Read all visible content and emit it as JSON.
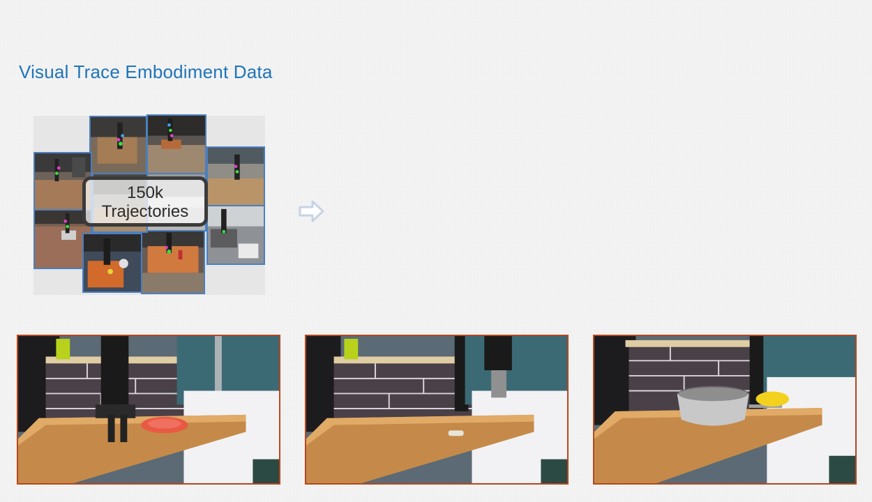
{
  "header": {
    "title": "Visual Trace Embodiment Data"
  },
  "collage": {
    "badge_line1": "150k",
    "badge_line2": "Trajectories",
    "tile_border_color": "#4a7fc0",
    "tile_count": 10
  },
  "arrow": {
    "icon": "right-arrow-icon",
    "color": "#c5d3e6"
  },
  "demos": {
    "frame_border_color": "#b8461c",
    "frames": [
      {
        "scene": "gripper-over-red-plate"
      },
      {
        "scene": "small-object-on-counter"
      },
      {
        "scene": "pot-and-yellow-corn"
      }
    ]
  },
  "colors": {
    "title": "#1f74b8"
  }
}
